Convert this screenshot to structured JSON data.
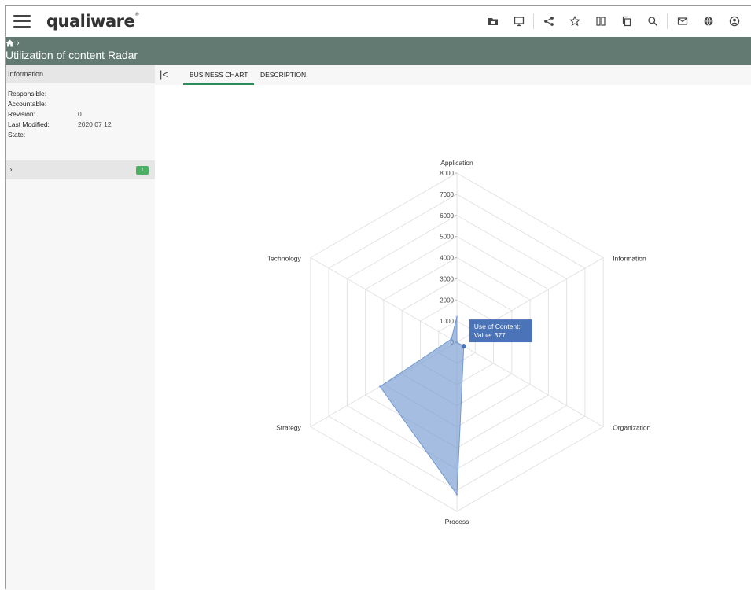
{
  "app": {
    "logo": "qualiware",
    "logo_mark": "®"
  },
  "toolbar": {
    "icons": [
      "folder-icon",
      "present-icon",
      "share-icon",
      "star-icon",
      "book-icon",
      "copy-icon",
      "search-icon",
      "mail-icon",
      "globe-icon",
      "user-icon"
    ]
  },
  "header": {
    "breadcrumb_sep": "›",
    "title": "Utilization of content Radar"
  },
  "sidebar": {
    "heading": "Information",
    "props": [
      {
        "key": "Responsible:",
        "value": ""
      },
      {
        "key": "Accountable:",
        "value": ""
      },
      {
        "key": "Revision:",
        "value": "0"
      },
      {
        "key": "Last Modified:",
        "value": "2020 07 12"
      },
      {
        "key": "State:",
        "value": ""
      }
    ],
    "row_chevron": "›",
    "row_badge": "1"
  },
  "tabs": {
    "items": [
      "BUSINESS CHART",
      "DESCRIPTION"
    ],
    "active": 0,
    "collapse": "|<"
  },
  "chart_data": {
    "type": "radar",
    "axes": [
      "Application",
      "Information",
      "Organization",
      "Process",
      "Strategy",
      "Technology"
    ],
    "rmax": 8000,
    "ticks": [
      0,
      1000,
      2000,
      3000,
      4000,
      5000,
      6000,
      7000,
      8000
    ],
    "series": [
      {
        "values": [
          1200,
          0,
          377,
          7200,
          4200,
          300
        ],
        "color": "#7399cf"
      }
    ],
    "tooltip": {
      "title": "Use of Content:",
      "text": "Value: 377",
      "color": "#4b74b8"
    }
  }
}
